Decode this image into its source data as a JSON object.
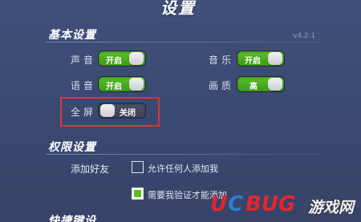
{
  "title": "设置",
  "version": "v4.2.1",
  "sections": {
    "basic": "基本设置",
    "permissions": "权限设置",
    "third": "快捷键设"
  },
  "settings": {
    "sound": {
      "label": "声音",
      "value": "开启"
    },
    "music": {
      "label": "音乐",
      "value": "开启"
    },
    "voice": {
      "label": "语音",
      "value": "开启"
    },
    "quality": {
      "label": "画质",
      "value": "高"
    },
    "fullscreen": {
      "label": "全屏",
      "value": "关闭"
    }
  },
  "permissions": {
    "add_friend_label": "添加好友",
    "options": [
      {
        "label": "允许任何人添加我",
        "checked": false
      },
      {
        "label": "需要我验证才能添加",
        "checked": true
      }
    ]
  },
  "watermark": {
    "brand_u": "U",
    "brand_c": "C",
    "brand_bug": "BUG",
    "suffix": "游戏网"
  },
  "colors": {
    "toggle_on": "#4aad1f",
    "highlight": "#d23a3a",
    "background": "#3c4a6e"
  }
}
